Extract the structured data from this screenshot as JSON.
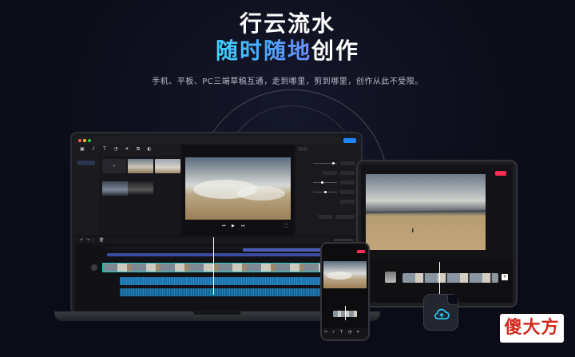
{
  "hero": {
    "line1": "行云流水",
    "line2_highlight": "随时随地",
    "line2_rest": "创作",
    "subtitle": "手机、平板、PC三端草稿互通，走到哪里，剪到哪里，创作从此不受限。"
  },
  "colors": {
    "accent_gradient_start": "#3fd6ff",
    "accent_gradient_end": "#6f8cff",
    "export_blue": "#1f86ff",
    "export_pink": "#ff2c55",
    "audio_track": "#1c6fa6",
    "video_track": "#3b4a9e",
    "watermark_red": "#d32a1d"
  },
  "desktop_app": {
    "toolbar_icons": [
      "media-icon",
      "audio-icon",
      "text-icon",
      "sticker-icon",
      "effects-icon",
      "transition-icon",
      "filter-icon"
    ],
    "sidebar_items": [
      "",
      ""
    ],
    "import_label": "",
    "player_label": "",
    "inspector_tabs": [
      "",
      "",
      ""
    ]
  },
  "watermark": {
    "text": "傻大方"
  },
  "icons": {
    "cloud": "cloud-icon",
    "play": "play-icon"
  }
}
